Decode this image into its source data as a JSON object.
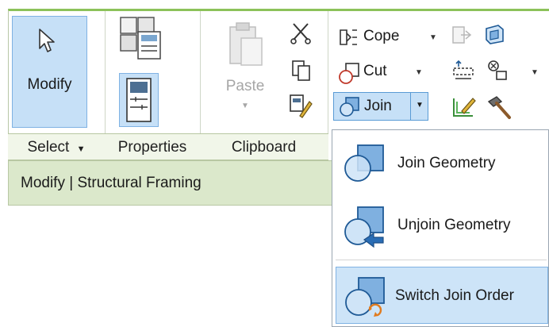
{
  "ribbon": {
    "select": {
      "modify_label": "Modify",
      "panel_label": "Select"
    },
    "properties": {
      "panel_label": "Properties"
    },
    "clipboard": {
      "paste_label": "Paste",
      "panel_label": "Clipboard"
    },
    "geometry": {
      "cope_label": "Cope",
      "cut_label": "Cut",
      "join_label": "Join"
    },
    "context_tab": "Modify | Structural Framing"
  },
  "join_menu": {
    "items": [
      {
        "label": "Join Geometry"
      },
      {
        "label": "Unjoin Geometry"
      },
      {
        "label": "Switch Join Order"
      }
    ]
  },
  "colors": {
    "ribbon_accent": "#8cc25a",
    "selected_fill": "#c6e0f7",
    "selected_border": "#7fb2e3",
    "context_bar": "#dbe8cb"
  },
  "icons": {
    "modify": "cursor-arrow-icon",
    "properties": "properties-palette-icon",
    "type_properties": "type-properties-icon",
    "paste": "paste-icon",
    "cut_clip": "scissors-icon",
    "copy": "copy-icon",
    "match_props": "match-type-properties-icon",
    "cope": "cope-icon",
    "cut_geo": "cut-geometry-icon",
    "join": "join-geometry-icon",
    "switch_join": "switch-join-order-icon",
    "unjoin": "unjoin-geometry-icon"
  }
}
